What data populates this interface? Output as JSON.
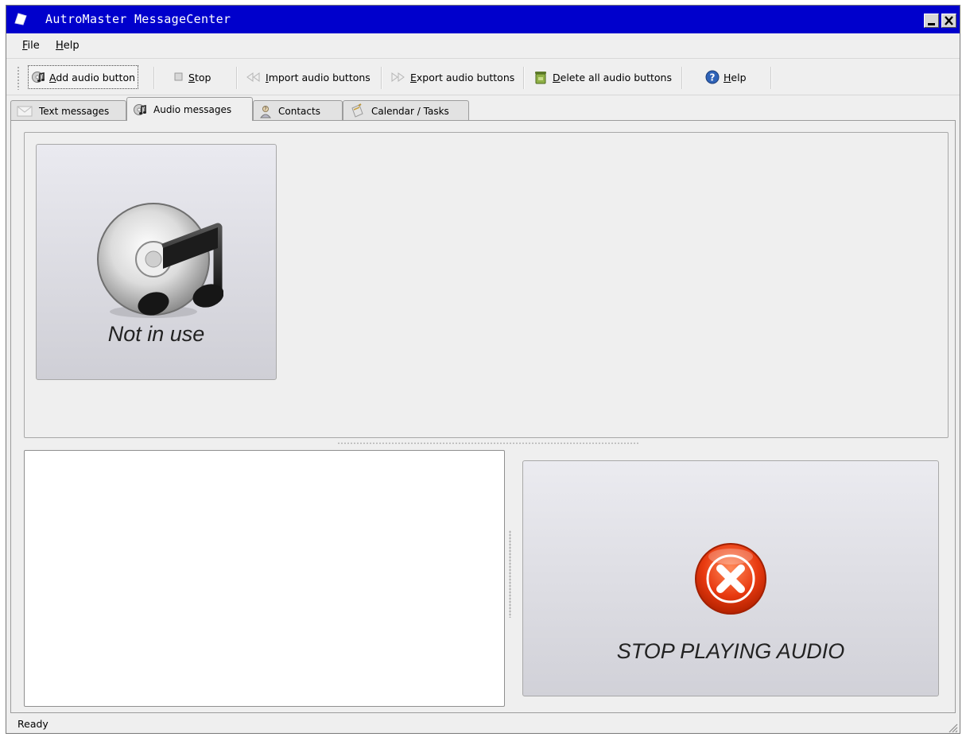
{
  "window": {
    "title": "AutroMaster MessageCenter"
  },
  "menu": [
    "File",
    "Help"
  ],
  "toolbar": {
    "add": "Add audio button",
    "stop": "Stop",
    "import": "Import audio buttons",
    "export": "Export audio buttons",
    "delete_all": "Delete all audio buttons",
    "help": "Help"
  },
  "tabs": [
    {
      "label": "Text messages",
      "icon": "envelope-icon"
    },
    {
      "label": "Audio messages",
      "icon": "audio-icon",
      "selected": true
    },
    {
      "label": "Contacts",
      "icon": "contact-icon"
    },
    {
      "label": "Calendar / Tasks",
      "icon": "calendar-icon"
    }
  ],
  "audio_buttons": [
    {
      "label": "Not in use",
      "icon": "cd-music-icon"
    }
  ],
  "stop_button": {
    "label": "STOP PLAYING AUDIO",
    "icon": "red-x-icon"
  },
  "status": "Ready",
  "colors": {
    "titlebar": "#0000cc",
    "background": "#efefef",
    "stop_red": "#e03a12"
  }
}
